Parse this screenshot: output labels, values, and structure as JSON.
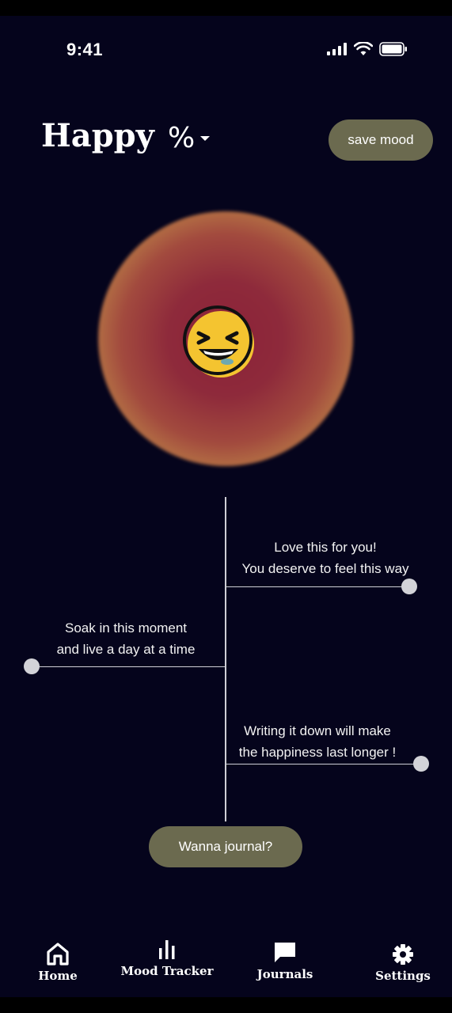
{
  "status_bar": {
    "time": "9:41"
  },
  "header": {
    "mood": "Happy",
    "mood_symbol": "%",
    "save_label": "save mood"
  },
  "orb": {
    "emoji_icon": "laughing-face-icon"
  },
  "timeline": {
    "messages": [
      {
        "line1": "Love this for you!",
        "line2": "You deserve to feel this way"
      },
      {
        "line1": "Soak in this moment",
        "line2": "and live a day at a time"
      },
      {
        "line1": "Writing it down will make",
        "line2": "the happiness last longer !"
      }
    ]
  },
  "journal_button": {
    "label": "Wanna journal?"
  },
  "nav": {
    "items": [
      {
        "label": "Home",
        "icon": "home-icon"
      },
      {
        "label": "Mood Tracker",
        "icon": "bar-chart-icon"
      },
      {
        "label": "Journals",
        "icon": "chat-bubble-icon"
      },
      {
        "label": "Settings",
        "icon": "gear-icon"
      }
    ]
  },
  "colors": {
    "background": "#05041c",
    "button": "#6b6a4f",
    "line": "#cfcfd6"
  }
}
